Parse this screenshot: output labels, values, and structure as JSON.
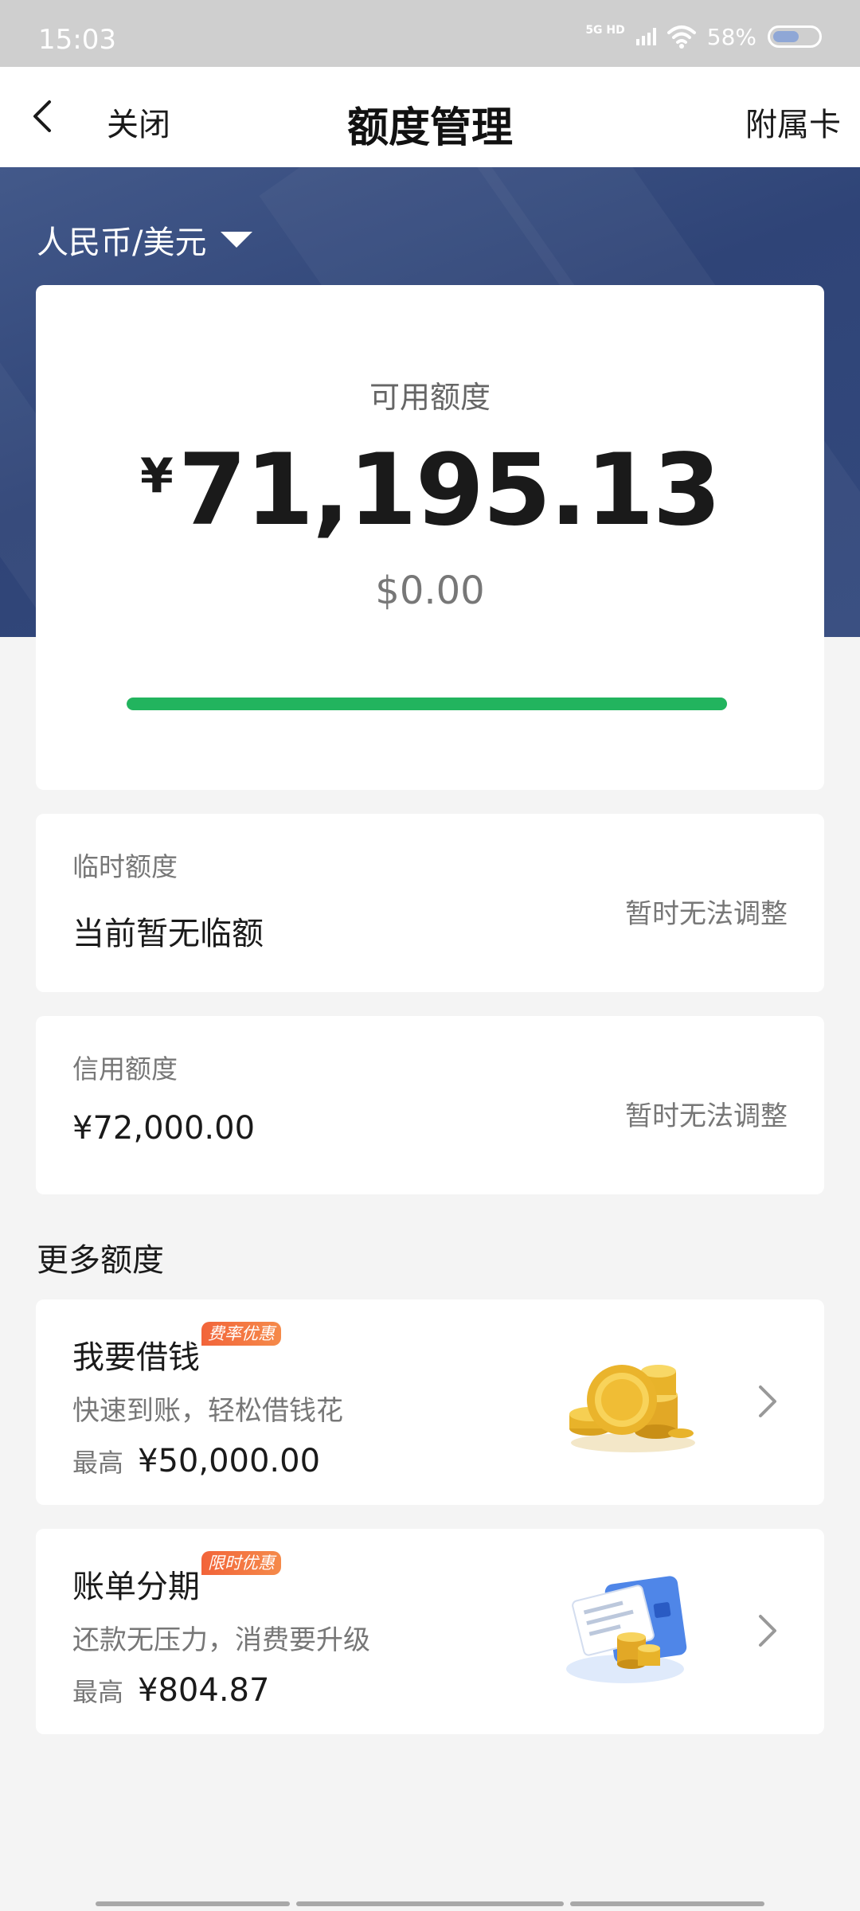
{
  "status_bar": {
    "time": "15:03",
    "network": "5G HD",
    "battery_percent": "58%",
    "battery_level": 0.58
  },
  "nav": {
    "close_label": "关闭",
    "title": "额度管理",
    "right_action": "附属卡"
  },
  "currency_selector": {
    "label": "人民币/美元"
  },
  "available": {
    "label": "可用额度",
    "cny_symbol": "¥",
    "cny_amount": "71,195.13",
    "usd_amount": "$0.00",
    "usage_fraction": 1.0,
    "progress_color": "#22b45e"
  },
  "temporary_limit": {
    "label": "临时额度",
    "value": "当前暂无临额",
    "action": "暂时无法调整"
  },
  "credit_limit": {
    "label": "信用额度",
    "value": "¥72,000.00",
    "action": "暂时无法调整"
  },
  "more_section": {
    "title": "更多额度"
  },
  "offers": [
    {
      "title": "我要借钱",
      "badge": "费率优惠",
      "description": "快速到账，轻松借钱花",
      "max_label": "最高",
      "max_value": "¥50,000.00",
      "icon": "gold-coins-icon"
    },
    {
      "title": "账单分期",
      "badge": "限时优惠",
      "description": "还款无压力，消费要升级",
      "max_label": "最高",
      "max_value": "¥804.87",
      "icon": "bill-card-coins-icon"
    }
  ],
  "colors": {
    "hero_blue": "#2f4477",
    "accent_green": "#22b45e",
    "badge_orange": "#f2643a"
  }
}
